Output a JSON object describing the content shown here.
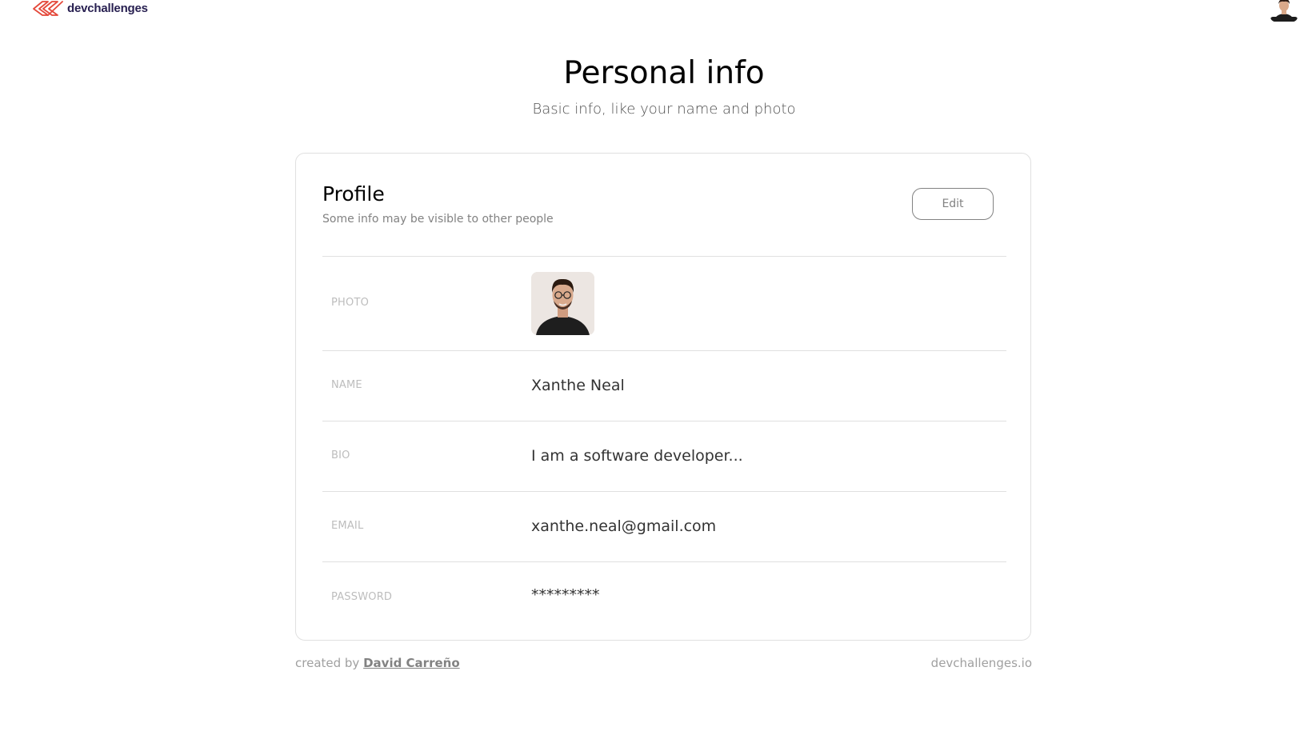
{
  "brand": {
    "logo_text": "devchallenges",
    "logo_color": "#E4483A"
  },
  "header": {
    "avatar_icon": "user-avatar-icon"
  },
  "page": {
    "title": "Personal info",
    "subtitle": "Basic info, like your name and photo"
  },
  "profile": {
    "title": "Profile",
    "subtitle": "Some info may be visible to other people",
    "edit_label": "Edit",
    "rows": [
      {
        "label": "PHOTO",
        "value": ""
      },
      {
        "label": "NAME",
        "value": "Xanthe Neal"
      },
      {
        "label": "BIO",
        "value": "I am a software developer..."
      },
      {
        "label": "EMAIL",
        "value": "xanthe.neal@gmail.com"
      },
      {
        "label": "PASSWORD",
        "value": "*********"
      }
    ]
  },
  "footer": {
    "created_by": "created by",
    "author": "David Carreño",
    "site": "devchallenges.io"
  }
}
